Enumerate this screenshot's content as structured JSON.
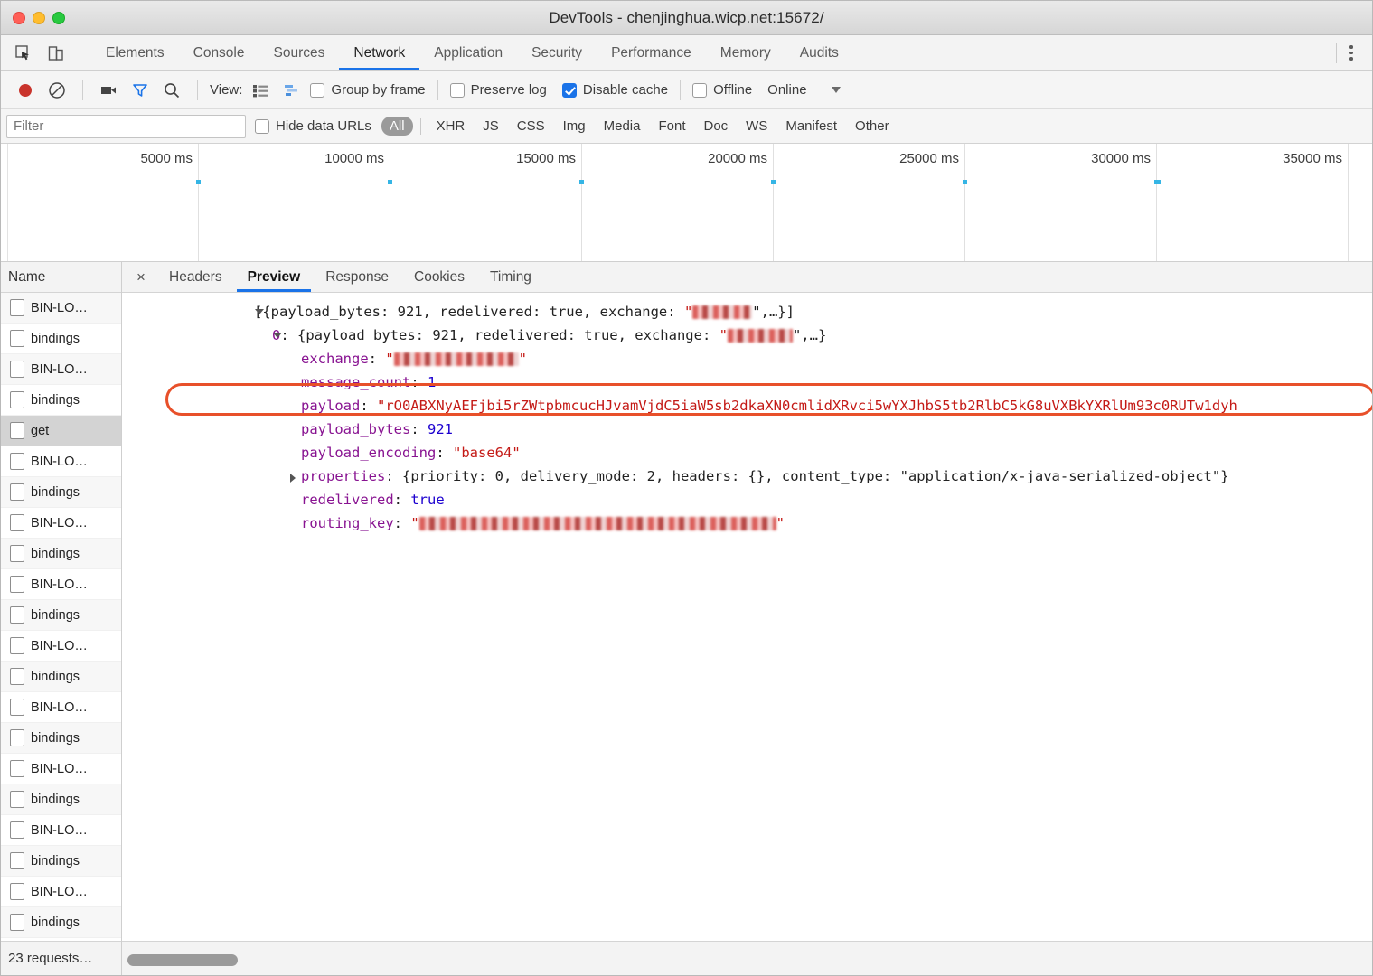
{
  "window": {
    "title": "DevTools - chenjinghua.wicp.net:15672/",
    "traffic_lights": [
      "close",
      "minimize",
      "maximize"
    ]
  },
  "panel_tabs": {
    "items": [
      {
        "label": "Elements",
        "active": false
      },
      {
        "label": "Console",
        "active": false
      },
      {
        "label": "Sources",
        "active": false
      },
      {
        "label": "Network",
        "active": true
      },
      {
        "label": "Application",
        "active": false
      },
      {
        "label": "Security",
        "active": false
      },
      {
        "label": "Performance",
        "active": false
      },
      {
        "label": "Memory",
        "active": false
      },
      {
        "label": "Audits",
        "active": false
      }
    ],
    "inspect_icon": "inspect-element-icon",
    "device_icon": "device-toolbar-icon",
    "more_icon": "kebab-menu-icon"
  },
  "network_toolbar": {
    "record_icon": "record-icon",
    "clear_icon": "clear-icon",
    "capture_screenshots_icon": "camera-icon",
    "filter_icon": "filter-icon",
    "search_icon": "search-icon",
    "view_label": "View:",
    "list_view_icon": "list-view-icon",
    "waterfall_view_icon": "waterfall-view-icon",
    "group_by_frame_label": "Group by frame",
    "group_by_frame_checked": false,
    "preserve_log_label": "Preserve log",
    "preserve_log_checked": false,
    "disable_cache_label": "Disable cache",
    "disable_cache_checked": true,
    "offline_label": "Offline",
    "offline_checked": false,
    "throttling_value": "Online",
    "throttling_caret_icon": "chevron-down-icon",
    "accent_color": "#1a73e8",
    "record_color": "#c9342c"
  },
  "filter_bar": {
    "filter_placeholder": "Filter",
    "filter_value": "",
    "hide_data_urls_label": "Hide data URLs",
    "hide_data_urls_checked": false,
    "types": [
      {
        "label": "All",
        "active": true
      },
      {
        "label": "XHR",
        "active": false
      },
      {
        "label": "JS",
        "active": false
      },
      {
        "label": "CSS",
        "active": false
      },
      {
        "label": "Img",
        "active": false
      },
      {
        "label": "Media",
        "active": false
      },
      {
        "label": "Font",
        "active": false
      },
      {
        "label": "Doc",
        "active": false
      },
      {
        "label": "WS",
        "active": false
      },
      {
        "label": "Manifest",
        "active": false
      },
      {
        "label": "Other",
        "active": false
      }
    ]
  },
  "overview": {
    "ruler_labels": [
      "5000 ms",
      "10000 ms",
      "15000 ms",
      "20000 ms",
      "25000 ms",
      "30000 ms",
      "35000 ms"
    ],
    "tick_color": "#35b5e5"
  },
  "requests_panel": {
    "column_header": "Name",
    "rows": [
      {
        "name": "BIN-LO…",
        "selected": false
      },
      {
        "name": "bindings",
        "selected": false
      },
      {
        "name": "BIN-LO…",
        "selected": false
      },
      {
        "name": "bindings",
        "selected": false
      },
      {
        "name": "get",
        "selected": true
      },
      {
        "name": "BIN-LO…",
        "selected": false
      },
      {
        "name": "bindings",
        "selected": false
      },
      {
        "name": "BIN-LO…",
        "selected": false
      },
      {
        "name": "bindings",
        "selected": false
      },
      {
        "name": "BIN-LO…",
        "selected": false
      },
      {
        "name": "bindings",
        "selected": false
      },
      {
        "name": "BIN-LO…",
        "selected": false
      },
      {
        "name": "bindings",
        "selected": false
      },
      {
        "name": "BIN-LO…",
        "selected": false
      },
      {
        "name": "bindings",
        "selected": false
      },
      {
        "name": "BIN-LO…",
        "selected": false
      },
      {
        "name": "bindings",
        "selected": false
      },
      {
        "name": "BIN-LO…",
        "selected": false
      },
      {
        "name": "bindings",
        "selected": false
      },
      {
        "name": "BIN-LO…",
        "selected": false
      },
      {
        "name": "bindings",
        "selected": false
      }
    ],
    "status_text": "23 requests…"
  },
  "detail_panel": {
    "close_label": "×",
    "tabs": [
      {
        "label": "Headers",
        "active": false
      },
      {
        "label": "Preview",
        "active": true
      },
      {
        "label": "Response",
        "active": false
      },
      {
        "label": "Cookies",
        "active": false
      },
      {
        "label": "Timing",
        "active": false
      }
    ]
  },
  "preview": {
    "root": {
      "prefix": "[{",
      "text": "payload_bytes: 921, redelivered: true, exchange: ",
      "quote": "\"",
      "suffix": "\",…}]"
    },
    "child": {
      "index": "0",
      "colon": ": {",
      "text": "payload_bytes: 921, redelivered: true, exchange: ",
      "suffix": "\",…}"
    },
    "fields": [
      {
        "key": "exchange",
        "value_redacted": true,
        "value": ""
      },
      {
        "key": "message_count",
        "value": "1",
        "value_type": "number"
      },
      {
        "key": "payload",
        "value": "rO0ABXNyAEFjbi5rZWtpbmcucHJvamVjdC5iaW5sb2dkaXN0cmlidXRvci5wYXJhbS5tb2RlbC5kG8uVXBkYXRlUm93c0RUTw1dyh",
        "value_type": "string",
        "highlighted": true
      },
      {
        "key": "payload_bytes",
        "value": "921",
        "value_type": "number"
      },
      {
        "key": "payload_encoding",
        "value": "base64",
        "value_type": "string"
      },
      {
        "key": "properties",
        "value": "{priority: 0, delivery_mode: 2, headers: {}, content_type: \"application/x-java-serialized-object\"}",
        "value_type": "object",
        "collapsed": true
      },
      {
        "key": "redelivered",
        "value": "true",
        "value_type": "boolean"
      },
      {
        "key": "routing_key",
        "value_redacted": true,
        "value": ""
      }
    ],
    "highlight_color": "#e8502a"
  }
}
